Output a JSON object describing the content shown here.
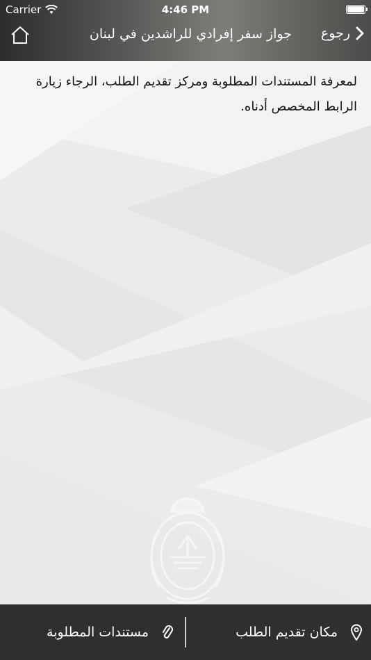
{
  "status_bar": {
    "carrier": "Carrier",
    "time": "4:46 PM"
  },
  "nav": {
    "title": "جواز سفر إفرادي للراشدين في لبنان",
    "back_label": "رجوع",
    "home_icon": "home-icon",
    "back_icon": "chevron-right-icon"
  },
  "content": {
    "intro_text": "لمعرفة المستندات المطلوبة ومركز تقديم الطلب، الرجاء زيارة الرابط المخصص أدناه."
  },
  "tabbar": {
    "location_label": "مكان تقديم الطلب",
    "location_icon": "map-pin-icon",
    "documents_label": "مستندات المطلوبة",
    "documents_icon": "paperclip-icon"
  },
  "colors": {
    "tabbar_bg": "#2f2f2f",
    "page_bg": "#ececec",
    "text": "#111111"
  }
}
